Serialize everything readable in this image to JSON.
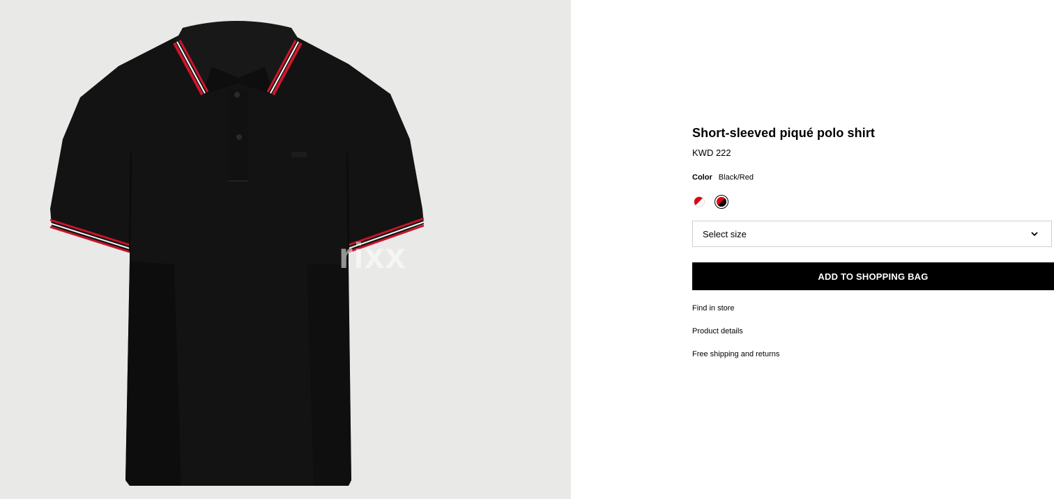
{
  "product": {
    "title": "Short-sleeved piqué polo shirt",
    "price": "KWD 222",
    "watermark": "rixx",
    "color_label": "Color",
    "color_value": "Black/Red",
    "swatches": [
      {
        "name": "White/Red",
        "colors": [
          "#e3000f",
          "#ffffff"
        ],
        "selected": false
      },
      {
        "name": "Black/Red",
        "colors": [
          "#e3000f",
          "#000000"
        ],
        "selected": true
      }
    ],
    "size_placeholder": "Select size",
    "add_to_bag": "ADD TO SHOPPING BAG",
    "links": [
      "Find in store",
      "Product details",
      "Free shipping and returns"
    ]
  },
  "colors": {
    "image_background": "#e9e9e8",
    "button": "#000000",
    "accent_red": "#e3000f"
  },
  "icons": {
    "size_dropdown": "chevron-down-icon"
  }
}
